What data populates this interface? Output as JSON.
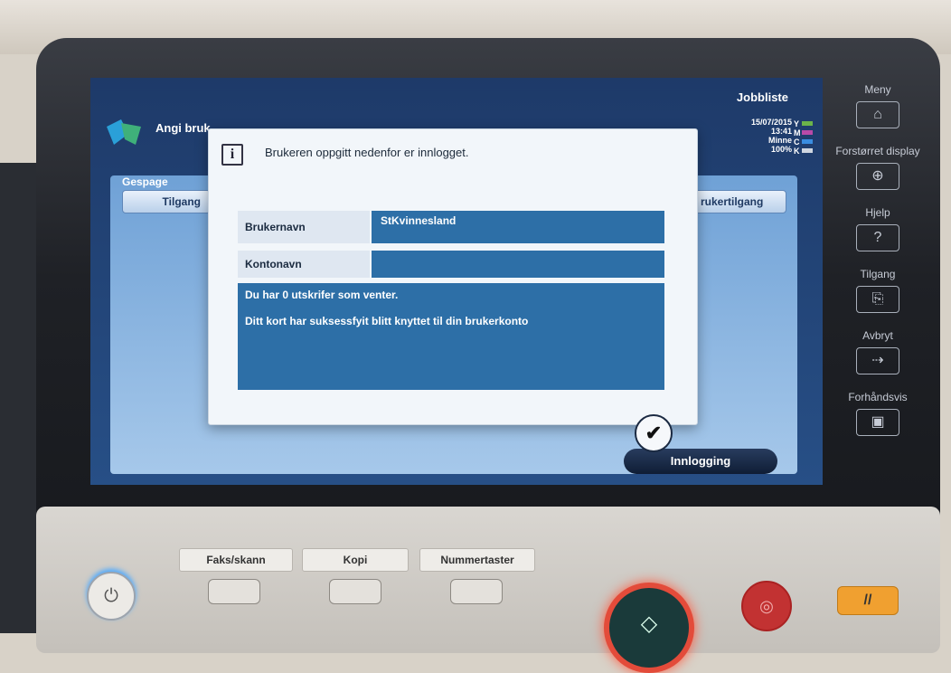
{
  "header": {
    "title": "Angi bruk",
    "jobbliste": "Jobbliste",
    "status": {
      "date": "15/07/2015",
      "time": "13:41",
      "memory_label": "Minne",
      "memory_value": "100%"
    },
    "toner": [
      {
        "letter": "Y",
        "color": "#6bb34a"
      },
      {
        "letter": "M",
        "color": "#b84aa8"
      },
      {
        "letter": "C",
        "color": "#3a8de0"
      },
      {
        "letter": "K",
        "color": "#cfd6e0"
      }
    ]
  },
  "background_panel": {
    "gespage_label": "Gespage",
    "tilgang_tab": "Tilgang",
    "brukertilgang_tab": "rukertilgang",
    "innlogging_button": "Innlogging"
  },
  "dialog": {
    "message": "Brukeren oppgitt nedenfor er innlogget.",
    "fields": [
      {
        "label": "Brukernavn",
        "value": "StKvinnesland"
      },
      {
        "label": "Kontonavn",
        "value": ""
      }
    ],
    "notice_lines": [
      "Du har 0 utskrifer som venter.",
      "Ditt kort har suksessfyit blitt knyttet til din brukerkonto"
    ],
    "ok_glyph": "✔"
  },
  "side_keys": [
    {
      "label": "Meny",
      "icon": "home-icon",
      "glyph": "⌂"
    },
    {
      "label": "Forstørret display",
      "icon": "zoom-icon",
      "glyph": "⊕"
    },
    {
      "label": "Hjelp",
      "icon": "help-icon",
      "glyph": "?"
    },
    {
      "label": "Tilgang",
      "icon": "access-icon",
      "glyph": "⎘"
    },
    {
      "label": "Avbryt",
      "icon": "interrupt-icon",
      "glyph": "⇢"
    },
    {
      "label": "Forhåndsvis",
      "icon": "preview-icon",
      "glyph": "▣"
    }
  ],
  "bottom_keys": [
    "Faks/skann",
    "Kopi",
    "Nummertaster"
  ],
  "hard_buttons": {
    "power_glyph": "⏻",
    "start_glyph": "◇",
    "stop_glyph": "◎",
    "reset_glyph": "//"
  },
  "colors": {
    "dialog_field": "#2d6fa7",
    "screen_bg": "#274f86",
    "start_ring": "#e34b3a"
  }
}
